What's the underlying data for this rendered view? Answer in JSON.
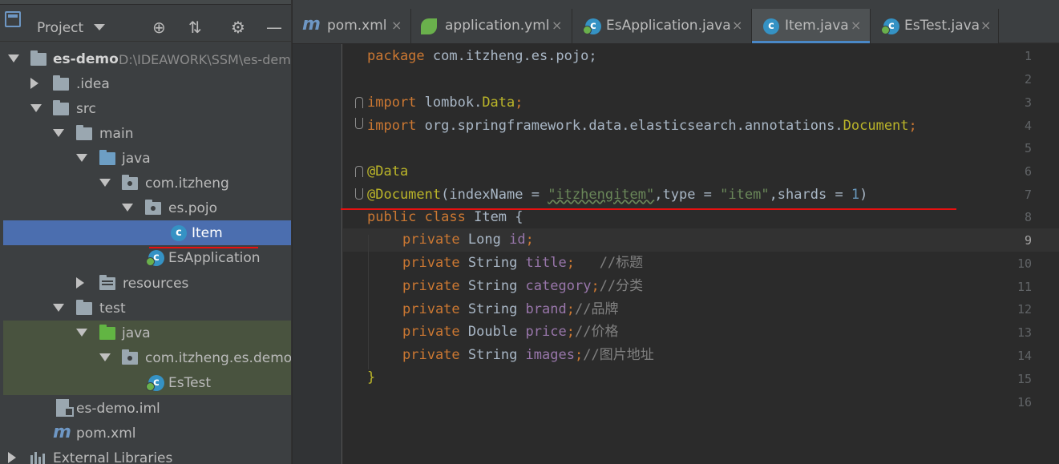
{
  "project_panel": {
    "title": "Project",
    "header_icons": [
      "crosshair-icon",
      "collapse-icon",
      "gear-icon",
      "minimize-icon"
    ],
    "tree": [
      {
        "id": "es-demo",
        "label": "es-demo",
        "path": "D:\\IDEAWORK\\SSM\\es-demo",
        "expanded": true
      },
      {
        "id": "idea",
        "label": ".idea",
        "expanded": false
      },
      {
        "id": "src",
        "label": "src",
        "expanded": true
      },
      {
        "id": "main",
        "label": "main",
        "expanded": true
      },
      {
        "id": "java",
        "label": "java",
        "expanded": true
      },
      {
        "id": "com-itzheng",
        "label": "com.itzheng",
        "expanded": true
      },
      {
        "id": "es-pojo",
        "label": "es.pojo",
        "expanded": true
      },
      {
        "id": "item",
        "label": "Item",
        "selected": true
      },
      {
        "id": "esapplication",
        "label": "EsApplication"
      },
      {
        "id": "resources",
        "label": "resources",
        "expanded": false
      },
      {
        "id": "test",
        "label": "test",
        "expanded": true
      },
      {
        "id": "test-java",
        "label": "java",
        "expanded": true
      },
      {
        "id": "com-itzheng-es-demo",
        "label": "com.itzheng.es.demo",
        "expanded": true
      },
      {
        "id": "estest",
        "label": "EsTest"
      },
      {
        "id": "es-demo-iml",
        "label": "es-demo.iml"
      },
      {
        "id": "pom-xml",
        "label": "pom.xml"
      },
      {
        "id": "external-libraries",
        "label": "External Libraries",
        "expanded": false
      }
    ]
  },
  "tabs": [
    {
      "label": "pom.xml",
      "icon": "maven-icon",
      "active": false
    },
    {
      "label": "application.yml",
      "icon": "spring-leaf-icon",
      "active": false
    },
    {
      "label": "EsApplication.java",
      "icon": "spring-class-icon",
      "active": false
    },
    {
      "label": "Item.java",
      "icon": "class-icon",
      "active": true
    },
    {
      "label": "EsTest.java",
      "icon": "spring-class-icon",
      "active": false
    }
  ],
  "tab_close": "×",
  "editor": {
    "current_line": 9,
    "line_numbers": [
      "1",
      "2",
      "3",
      "4",
      "5",
      "6",
      "7",
      "8",
      "9",
      "10",
      "11",
      "12",
      "13",
      "14",
      "15",
      "16"
    ],
    "lines": {
      "l1": {
        "kw": "package",
        "rest": " com.itzheng.es.pojo;"
      },
      "l3": {
        "kw": "import",
        "rest": " lombok.",
        "cls": "Data",
        "end": ";"
      },
      "l4": {
        "kw": "import",
        "rest": " org.springframework.data.elasticsearch.annotations.",
        "cls": "Document",
        "end": ";"
      },
      "l6": {
        "ann": "@Data"
      },
      "l7": {
        "ann": "@Document",
        "p1": "(indexName = ",
        "s1": "\"itzhengitem\"",
        "p2": ",type = ",
        "s2": "\"item\"",
        "p3": ",shards = ",
        "n1": "1",
        "p4": ")"
      },
      "l8": {
        "kw1": "public",
        "kw2": "class",
        "rest": " Item {"
      },
      "l9": {
        "kw": "private",
        "type": " Long ",
        "fld": "id",
        "end": ";",
        "cmt": ""
      },
      "l10": {
        "kw": "private",
        "type": " String ",
        "fld": "title",
        "end": ";",
        "cmt": "   //标题"
      },
      "l11": {
        "kw": "private",
        "type": " String ",
        "fld": "category",
        "end": ";",
        "cmt": "//分类"
      },
      "l12": {
        "kw": "private",
        "type": " String ",
        "fld": "brand",
        "end": ";",
        "cmt": "//品牌"
      },
      "l13": {
        "kw": "private",
        "type": " Double ",
        "fld": "price",
        "end": ";",
        "cmt": "//价格"
      },
      "l14": {
        "kw": "private",
        "type": " String ",
        "fld": "images",
        "end": ";",
        "cmt": "//图片地址"
      },
      "l15": {
        "rest": "}"
      }
    }
  },
  "colors": {
    "keyword": "#cc7832",
    "annotation": "#bbb529",
    "string": "#6a8759",
    "number": "#6897bb",
    "field": "#9876aa",
    "comment": "#808080",
    "selection": "#4b6eaf",
    "annotation_underline": "#e81010"
  }
}
